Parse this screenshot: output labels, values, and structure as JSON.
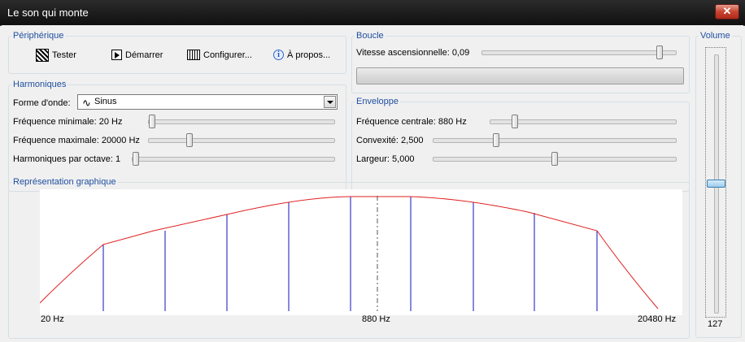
{
  "window": {
    "title": "Le son qui monte",
    "close_glyph": "✕"
  },
  "peripherique": {
    "legend": "Périphérique",
    "buttons": [
      {
        "label": "Tester",
        "icon": "test-icon"
      },
      {
        "label": "Démarrer",
        "icon": "play-icon"
      },
      {
        "label": "Configurer...",
        "icon": "configure-icon"
      },
      {
        "label": "À propos...",
        "icon": "info-icon"
      }
    ]
  },
  "boucle": {
    "legend": "Boucle",
    "vitesse_label": "Vitesse ascensionnelle: 0,09",
    "vitesse_fraction": 0.93,
    "progress_fraction": 0.0
  },
  "harmoniques": {
    "legend": "Harmoniques",
    "forme_label": "Forme d'onde:",
    "forme_value": "Sinus",
    "freq_min_label": "Fréquence minimale: 20 Hz",
    "freq_min_fraction": 0.0,
    "freq_max_label": "Fréquence maximale: 20000 Hz",
    "freq_max_fraction": 0.21,
    "harm_octave_label": "Harmoniques par octave: 1",
    "harm_octave_fraction": 0.0
  },
  "enveloppe": {
    "legend": "Enveloppe",
    "freq_centrale_label": "Fréquence centrale: 880 Hz",
    "freq_centrale_fraction": 0.12,
    "convexite_label": "Convexité: 2,500",
    "convexite_fraction": 0.25,
    "largeur_label": "Largeur: 5,000",
    "largeur_fraction": 0.5
  },
  "representation": {
    "legend": "Représentation graphique",
    "x_left": "20 Hz",
    "x_center": "880 Hz",
    "x_right": "20480 Hz"
  },
  "volume": {
    "legend": "Volume",
    "value": "127",
    "fraction": 0.5
  },
  "colors": {
    "curve": "#e02020",
    "harmonics": "#1010c0",
    "center_line": "#555555",
    "legend_text": "#1f4fa0"
  }
}
